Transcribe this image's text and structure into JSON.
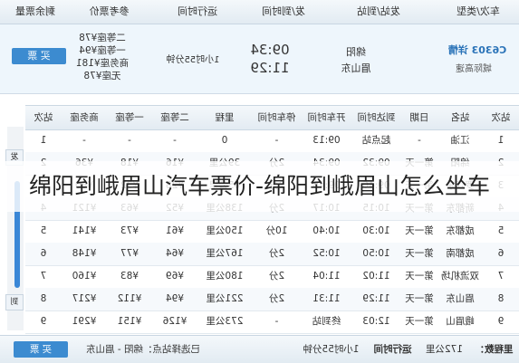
{
  "header": {
    "col_train": "车次/类型",
    "col_station": "发站/到站",
    "col_time": "发/到时间",
    "col_duration": "运行时间",
    "col_price": "参考票价",
    "col_remain": "剩余票量"
  },
  "train": {
    "number": "C6303 详情",
    "from_label": "城际高速",
    "station_from": "绵阳",
    "station_to": "眉山东",
    "depart": "09:34",
    "arrive": "11:29",
    "duration": "1小时55分钟",
    "price_second": "二等座¥78",
    "price_first": "一等座¥94",
    "price_business": "商务座¥181",
    "price_none": "无座¥78",
    "buy": "买 票"
  },
  "stops_header": {
    "station_no": "站次",
    "station": "站名",
    "day": "日期",
    "arrive": "到达时间",
    "depart": "开车时间",
    "stop": "停车时间",
    "mileage": "里程",
    "second": "二等座",
    "first": "一等座",
    "business": "商务座",
    "seq": "站次"
  },
  "stops": [
    {
      "no": "1",
      "station": "江油",
      "day": "-",
      "arr": "起点站",
      "dep": "09:13",
      "stop": "-",
      "km": "0",
      "second": "-",
      "first": "-",
      "biz": "-"
    },
    {
      "no": "2",
      "station": "绵阳",
      "day": "第一天",
      "arr": "09:32",
      "dep": "09:34",
      "stop": "2分",
      "km": "39公里",
      "second": "¥16",
      "first": "¥18",
      "biz": "¥36"
    },
    {
      "no": "3",
      "station": "罗江东",
      "day": "第一天",
      "arr": "09:46",
      "dep": "09:48",
      "stop": "2分",
      "km": "65公里",
      "second": "¥28",
      "first": "¥32",
      "biz": "¥60"
    },
    {
      "no": "4",
      "station": "新都东",
      "day": "第一天",
      "arr": "10:15",
      "dep": "10:17",
      "stop": "2分",
      "km": "138公里",
      "second": "¥52",
      "first": "¥63",
      "biz": "¥121"
    },
    {
      "no": "5",
      "station": "成都东",
      "day": "第一天",
      "arr": "10:30",
      "dep": "10:40",
      "stop": "10分",
      "km": "150公里",
      "second": "¥61",
      "first": "¥73",
      "biz": "¥141"
    },
    {
      "no": "6",
      "station": "成都南",
      "day": "第一天",
      "arr": "10:50",
      "dep": "10:52",
      "stop": "2分",
      "km": "167公里",
      "second": "¥64",
      "first": "¥77",
      "biz": "¥148"
    },
    {
      "no": "7",
      "station": "双流机场",
      "day": "第一天",
      "arr": "11:02",
      "dep": "11:04",
      "stop": "2分",
      "km": "180公里",
      "second": "¥69",
      "first": "¥83",
      "biz": "¥160"
    },
    {
      "no": "8",
      "station": "眉山东",
      "day": "第一天",
      "arr": "11:29",
      "dep": "11:31",
      "stop": "2分",
      "km": "221公里",
      "second": "¥94",
      "first": "¥112",
      "biz": "¥217"
    },
    {
      "no": "9",
      "station": "峨眉山",
      "day": "第一天",
      "arr": "12:03",
      "dep": "终到站",
      "stop": "-",
      "km": "273公里",
      "second": "¥126",
      "first": "¥151",
      "biz": "¥291"
    }
  ],
  "footer": {
    "label": "里程数：",
    "km": "172公里",
    "runtime_label": "运行时间",
    "runtime": "1小时55分钟",
    "chosen": "已选择站点：绵阳 - 眉山东",
    "buy": "买 票"
  },
  "scroll": {
    "up": "发",
    "down": "到"
  },
  "overlay": {
    "title": "绵阳到峨眉山汽车票价-绵阳到峨眉山怎么坐车"
  }
}
